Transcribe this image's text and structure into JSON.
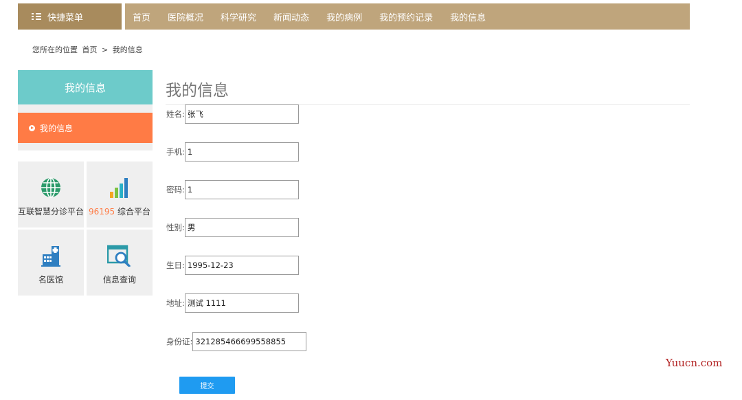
{
  "topbar": {
    "quick_menu_label": "快捷菜单",
    "nav_items": [
      "首页",
      "医院概况",
      "科学研究",
      "新闻动态",
      "我的病例",
      "我的预约记录",
      "我的信息"
    ]
  },
  "breadcrumb": {
    "prefix": "您所在的位置",
    "home": "首页",
    "separator": ">",
    "current": "我的信息"
  },
  "sidebar": {
    "header": "我的信息",
    "active_item": "我的信息",
    "tiles": [
      {
        "icon": "globe-icon",
        "label": "互联智慧分诊平台",
        "label_highlight": "",
        "label_rest": ""
      },
      {
        "icon": "bar-chart-icon",
        "label": "",
        "label_highlight": "96195",
        "label_rest": " 综合平台"
      },
      {
        "icon": "hospital-building-icon",
        "label": "名医馆",
        "label_highlight": "",
        "label_rest": ""
      },
      {
        "icon": "search-window-icon",
        "label": "信息查询",
        "label_highlight": "",
        "label_rest": ""
      }
    ]
  },
  "main": {
    "title": "我的信息",
    "fields": [
      {
        "label": "姓名:",
        "value": "张飞"
      },
      {
        "label": "手机:",
        "value": "1"
      },
      {
        "label": "密码:",
        "value": "1"
      },
      {
        "label": "性别:",
        "value": "男"
      },
      {
        "label": "生日:",
        "value": "1995-12-23"
      },
      {
        "label": "地址:",
        "value": "测试 1111"
      },
      {
        "label": "身份证:",
        "value": "321285466699558855"
      }
    ],
    "submit_label": "提交"
  },
  "watermark": "Yuucn.com",
  "colors": {
    "topbar": "#bfa57c",
    "quick_menu": "#a88b5d",
    "sidebar_header": "#6dcbca",
    "sidebar_active": "#ff7b45",
    "submit_button": "#1f9bf1",
    "highlight_text": "#ff7b45"
  }
}
